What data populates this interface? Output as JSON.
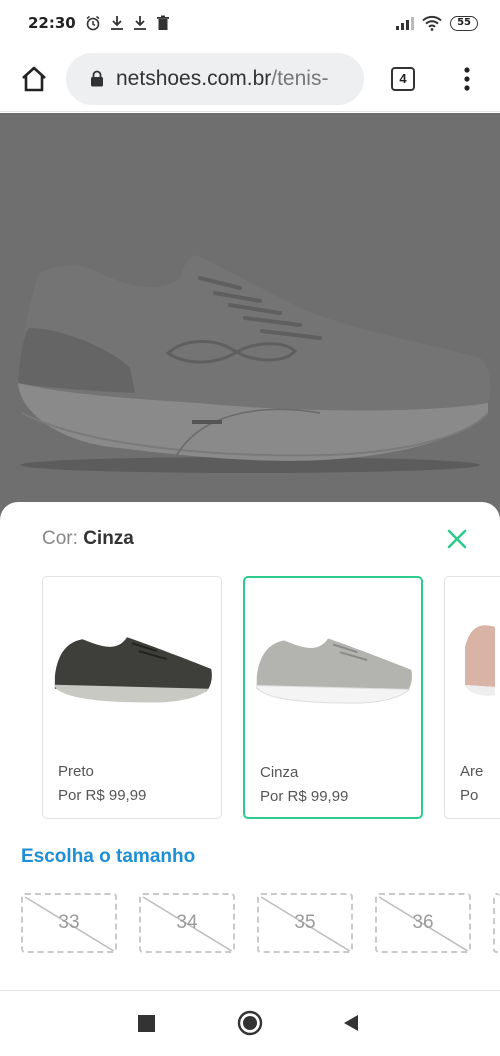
{
  "status_bar": {
    "time": "22:30",
    "battery": "55",
    "left_icons": [
      "alarm-icon",
      "download-icon",
      "download-icon",
      "trash-icon"
    ],
    "right_icons": [
      "signal-icon",
      "wifi-icon",
      "battery-icon"
    ]
  },
  "browser": {
    "url_domain": "netshoes.com.br",
    "url_path": "/tenis-",
    "tab_count": "4"
  },
  "sheet": {
    "color_label": "Cor:",
    "color_value": "Cinza",
    "options": [
      {
        "name": "Preto",
        "price": "Por R$ 99,99",
        "selected": false,
        "color": "#3e3e3a"
      },
      {
        "name": "Cinza",
        "price": "Por R$ 99,99",
        "selected": true,
        "color": "#b3b3b0"
      },
      {
        "name": "Are",
        "price": "Po",
        "selected": false,
        "color": "#d9b3a6"
      }
    ],
    "size_title": "Escolha o tamanho",
    "sizes": [
      "33",
      "34",
      "35",
      "36"
    ]
  },
  "colors": {
    "accent_green": "#2ecb8e",
    "link_blue": "#1e8fd6"
  }
}
